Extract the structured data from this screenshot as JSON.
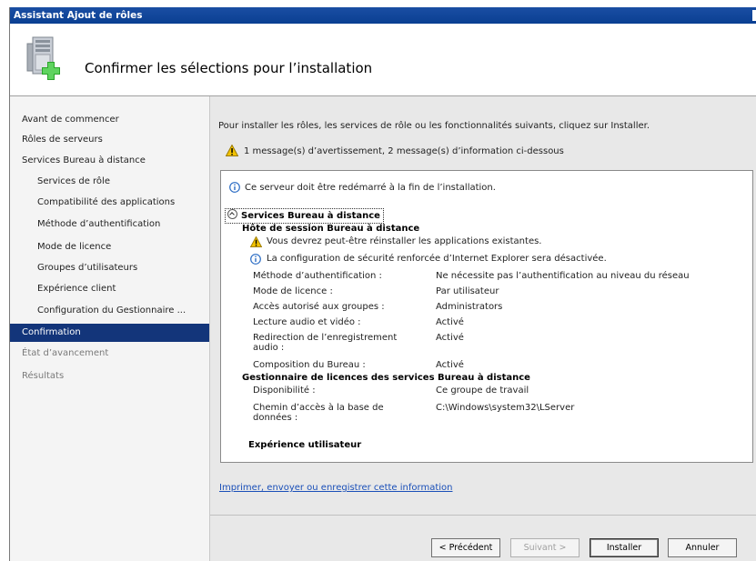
{
  "window": {
    "title": "Assistant Ajout de rôles"
  },
  "header": {
    "title": "Confirmer les sélections pour l’installation",
    "icon": "server-add-role-icon"
  },
  "nav": {
    "items": [
      {
        "label": "Avant de commencer",
        "level": "top",
        "state": "normal"
      },
      {
        "label": "Rôles de serveurs",
        "level": "top",
        "state": "normal"
      },
      {
        "label": "Services Bureau à distance",
        "level": "top",
        "state": "normal"
      },
      {
        "label": "Services de rôle",
        "level": "sub",
        "state": "normal"
      },
      {
        "label": "Compatibilité des applications",
        "level": "sub",
        "state": "normal"
      },
      {
        "label": "Méthode d’authentification",
        "level": "sub",
        "state": "normal"
      },
      {
        "label": "Mode de licence",
        "level": "sub",
        "state": "normal"
      },
      {
        "label": "Groupes d’utilisateurs",
        "level": "sub",
        "state": "normal"
      },
      {
        "label": "Expérience client",
        "level": "sub",
        "state": "normal"
      },
      {
        "label": "Configuration du Gestionnaire ...",
        "level": "sub",
        "state": "normal"
      },
      {
        "label": "Confirmation",
        "level": "top",
        "state": "selected"
      },
      {
        "label": "État d’avancement",
        "level": "top",
        "state": "disabled"
      },
      {
        "label": "Résultats",
        "level": "top",
        "state": "disabled"
      }
    ]
  },
  "content": {
    "intro": "Pour installer les rôles, les services de rôle ou les fonctionnalités suivants, cliquez sur Installer.",
    "warning_summary": "1 message(s) d’avertissement, 2 message(s) d’information ci-dessous",
    "details": {
      "restart_note": "Ce serveur doit être redémarré à la fin de l’installation.",
      "section_title": "Services Bureau à distance",
      "rdsh": {
        "title": "Hôte de session Bureau à distance",
        "warning": "Vous devrez peut-être réinstaller les applications existantes.",
        "info": "La configuration de sécurité renforcée d’Internet Explorer sera désactivée.",
        "rows": [
          {
            "label": "Méthode d’authentification :",
            "value": "Ne nécessite pas l’authentification au niveau du réseau"
          },
          {
            "label": "Mode de licence :",
            "value": "Par utilisateur"
          },
          {
            "label": "Accès autorisé aux groupes :",
            "value": "Administrators"
          },
          {
            "label": "Lecture audio et vidéo :",
            "value": "Activé"
          },
          {
            "label": "Redirection de l’enregistrement audio :",
            "value": "Activé"
          },
          {
            "label": "Composition du Bureau :",
            "value": "Activé"
          }
        ]
      },
      "licensing": {
        "title": "Gestionnaire de licences des services Bureau à distance",
        "rows": [
          {
            "label": "Disponibilité :",
            "value": "Ce groupe de travail"
          },
          {
            "label": "Chemin d’accès à la base de données :",
            "value": "C:\\Windows\\system32\\LServer"
          }
        ]
      },
      "experience_title": "Expérience utilisateur"
    },
    "print_link": "Imprimer, envoyer ou enregistrer cette information"
  },
  "footer": {
    "previous": "< Précédent",
    "next": "Suivant >",
    "install": "Installer",
    "cancel": "Annuler"
  },
  "colors": {
    "title_bar": "#0a3f92",
    "nav_selected": "#13357a",
    "link": "#1a4fb8",
    "warning": "#f2c200",
    "info": "#2b6cc4"
  }
}
